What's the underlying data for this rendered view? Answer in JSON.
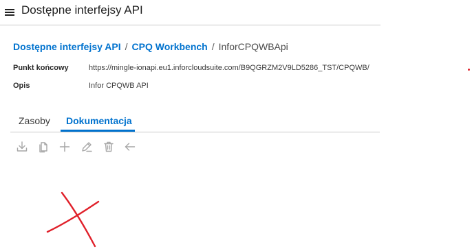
{
  "header": {
    "title": "Dostępne interfejsy API",
    "menu_icon": "hamburger-menu-icon"
  },
  "breadcrumb": {
    "items": [
      "Dostępne interfejsy API",
      "CPQ Workbench"
    ],
    "separator": "/",
    "current": "InforCPQWBApi"
  },
  "details": {
    "endpoint_label": "Punkt końcowy",
    "endpoint_value": "https://mingle-ionapi.eu1.inforcloudsuite.com/B9QGRZM2V9LD5286_TST/CPQWB/",
    "description_label": "Opis",
    "description_value": "Infor CPQWB API"
  },
  "tabs": [
    {
      "label": "Zasoby",
      "active": false
    },
    {
      "label": "Dokumentacja",
      "active": true
    }
  ],
  "toolbar": {
    "icons": [
      "download-icon",
      "copy-icon",
      "add-icon",
      "edit-icon",
      "delete-icon",
      "back-arrow-icon"
    ]
  },
  "colors": {
    "accent": "#0072ce",
    "annotation": "#e0202a",
    "toolbar_icon": "#a6a6a6"
  }
}
